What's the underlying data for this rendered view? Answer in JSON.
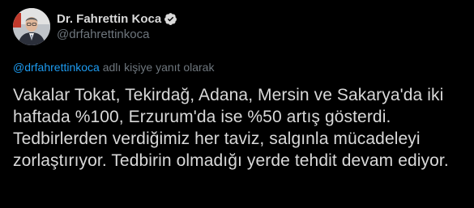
{
  "author": {
    "display_name": "Dr. Fahrettin Koca",
    "handle": "@drfahrettinkoca",
    "verified": true,
    "avatar": "profile-photo"
  },
  "reply_context": {
    "mention": "@drfahrettinkoca",
    "suffix": " adlı kişiye yanıt olarak"
  },
  "tweet": {
    "text": "Vakalar Tokat, Tekirdağ, Adana, Mersin ve Sakarya'da iki haftada %100, Erzurum'da ise %50 artış gösterdi. Tedbirlerden verdiğimiz her taviz, salgınla mücadeleyi zorlaştırıyor. Tedbirin olmadığı yerde tehdit devam ediyor."
  },
  "colors": {
    "background": "#000000",
    "text": "#d9d9d9",
    "muted": "#6e767d",
    "accent": "#1d9bf0"
  }
}
